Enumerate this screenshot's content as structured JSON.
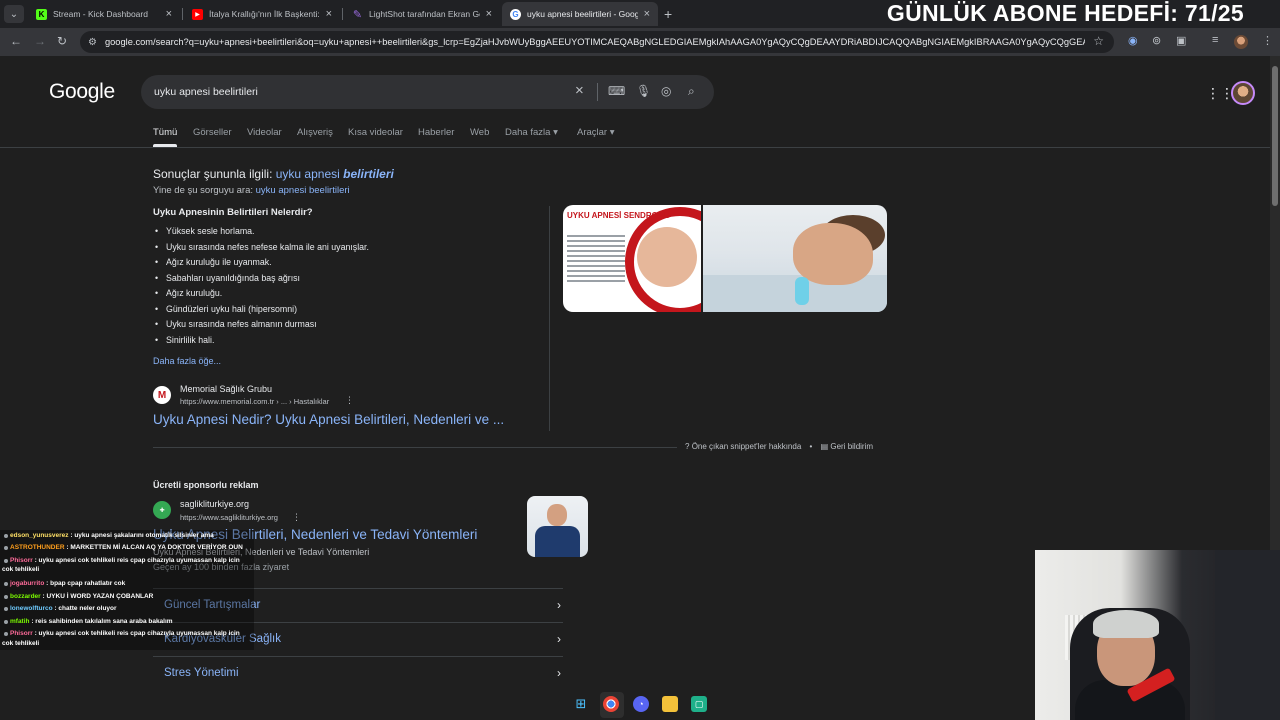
{
  "tabs": [
    {
      "title": "Stream - Kick Dashboard",
      "favicon": "kick-icon",
      "color": "#53fc18"
    },
    {
      "title": "İtalya Krallığı'nın İlk Başkenti: To",
      "favicon": "youtube-icon",
      "color": "#ff0000"
    },
    {
      "title": "LightShot tarafından Ekran Gör",
      "favicon": "lightshot-icon",
      "color": "#9b6be0"
    },
    {
      "title": "uyku apnesi beelirtileri - Google",
      "favicon": "google-icon",
      "color": "#4285f4",
      "active": true
    }
  ],
  "overlay_goal": "GÜNLÜK ABONE HEDEFİ: 71/25",
  "address_url": "google.com/search?q=uyku+apnesi+beelirtileri&oq=uyku+apnesi++beelirtileri&gs_lcrp=EgZjaHJvbWUyBggAEEUYOTIMCAEQABgNGLEDGIAEMgkIAhAAGA0YgAQyCQgDEAAYDRiABDIJCAQQABgNGIAEMgkIBRAAGA0YgAQyCQgGEAAYD...",
  "google": {
    "logo": "Google",
    "query": "uyku apnesi beelirtileri",
    "filters": [
      "Tümü",
      "Görseller",
      "Videolar",
      "Alışveriş",
      "Kısa videolar",
      "Haberler",
      "Web",
      "Daha fazla",
      "Araçlar"
    ]
  },
  "spelling": {
    "prefix": "Sonuçlar şununla ilgili:",
    "corrected_plain": "uyku apnesi ",
    "corrected_bold": "belirtileri",
    "instead_prefix": "Yine de şu sorguyu ara:",
    "instead_query": "uyku apnesi beelirtileri"
  },
  "snippet": {
    "title": "Uyku Apnesinin Belirtileri Nelerdir?",
    "items": [
      "Yüksek sesle horlama.",
      "Uyku sırasında nefes nefese kalma ile ani uyanışlar.",
      "Ağız kuruluğu ile uyanmak.",
      "Sabahları uyanıldığında baş ağrısı",
      "Ağız kuruluğu.",
      "Gündüzleri uyku hali (hipersomni)",
      "Uyku sırasında nefes almanın durması",
      "Sinirlilik hali."
    ],
    "more": "Daha fazla öğe...",
    "source_name": "Memorial Sağlık Grubu",
    "source_url": "https://www.memorial.com.tr › ... › Hastalıklar",
    "source_initial": "M",
    "result_title": "Uyku Apnesi Nedir? Uyku Apnesi Belirtileri, Nedenleri ve ...",
    "image1_banner": "UYKU APNESİ SENDROMU",
    "about": "Öne çıkan snippet'ler hakkında",
    "feedback": "Geri bildirim"
  },
  "ad": {
    "label": "Ücretli sponsorlu reklam",
    "site": "saglikliturkiye.org",
    "url": "https://www.saglikliturkiye.org",
    "title": "Uyku Apnesi Belirtileri, Nedenleri ve Tedavi Yöntemleri",
    "desc": "Uyku Apnesi Belirtileri, Nedenleri ve Tedavi Yöntemleri",
    "sub": "Geçen ay 100 binden fazla ziyaret",
    "sitelinks": [
      "Güncel Tartışmalar",
      "Kardiyovasküler Sağlık",
      "Stres Yönetimi"
    ]
  },
  "chat": [
    {
      "user": "edson_yunusverez",
      "text": ": uyku apnesi şakalarını otomatik silsinler ama",
      "color": "#ffe066"
    },
    {
      "user": "ASTROTHUNDER",
      "text": ": MARKETTEN Mİ ALCAN AQ YA DOKTOR VERİYOR OUN",
      "color": "#ff9f1c"
    },
    {
      "user": "Phisorr",
      "text": ": uyku apnesi cok tehlikeli reis cpap cihazıyla uyumassan kalp icin",
      "color": "#ff6b9a"
    },
    {
      "user": "",
      "text": "cok tehlikeli",
      "color": "#ffffff"
    },
    {
      "user": "jogaburrito",
      "text": ": bpap cpap rahatlatır cok",
      "color": "#ff6b9a"
    },
    {
      "user": "bozzarder",
      "text": ": UYKU İ WORD YAZAN ÇOBANLAR",
      "color": "#7cfc00"
    },
    {
      "user": "lonewolfturco",
      "text": ": chatte neler oluyor",
      "color": "#6ecbff"
    },
    {
      "user": "mfatih",
      "text": ": reis sahibinden takılalım sana araba bakalım",
      "color": "#7cfc00"
    },
    {
      "user": "Phisorr",
      "text": ": uyku apnesi cok tehlikeli reis cpap cihazıyla uyumassan kalp icin",
      "color": "#ff6b9a"
    },
    {
      "user": "",
      "text": "cok tehlikeli",
      "color": "#ffffff"
    }
  ]
}
